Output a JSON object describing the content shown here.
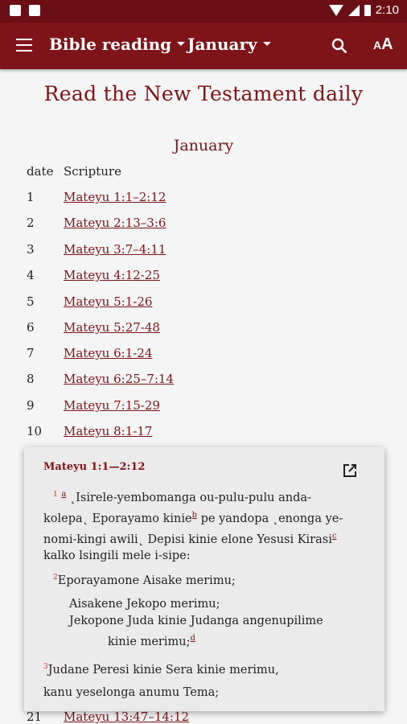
{
  "status": {
    "time": "2:10"
  },
  "appbar": {
    "dropdown_book": "Bible reading",
    "dropdown_month": "January",
    "icons": [
      "menu-icon",
      "search-icon",
      "text-size-icon"
    ],
    "text_size_label": "AA"
  },
  "page": {
    "title": "Read the New Testament daily",
    "month": "January",
    "col_date": "date",
    "col_scripture": "Scripture",
    "rows": [
      {
        "date": "1",
        "ref": "Mateyu 1:1–2:12"
      },
      {
        "date": "2",
        "ref": "Mateyu 2:13–3:6"
      },
      {
        "date": "3",
        "ref": "Mateyu 3:7–4:11"
      },
      {
        "date": "4",
        "ref": "Mateyu 4:12-25"
      },
      {
        "date": "5",
        "ref": "Mateyu 5:1-26"
      },
      {
        "date": "6",
        "ref": "Mateyu 5:27-48"
      },
      {
        "date": "7",
        "ref": "Mateyu 6:1-24"
      },
      {
        "date": "8",
        "ref": "Mateyu 6:25–7:14"
      },
      {
        "date": "9",
        "ref": "Mateyu 7:15-29"
      },
      {
        "date": "10",
        "ref": "Mateyu 8:1-17"
      },
      {
        "date": "21",
        "ref": "Mateyu 13:47–14:12"
      }
    ]
  },
  "popup": {
    "title": "Mateyu 1:1—2:12",
    "v1_num": "1",
    "v1_fn_a": "a",
    "v1_line1": "˛Isirele-yembomanga ou-pulu-pulu anda-",
    "v1_line2": "kolepa˛ Eporayamo kinie",
    "v1_fn_b": "b",
    "v1_line2b": " pe yandopa ˛enonga ye-",
    "v1_line3": "nomi-kingi awili˛ Depisi kinie elone Yesusi Kirasi",
    "v1_fn_c": "c",
    "v1_line4": "kalko lsingili mele i-sipe:",
    "v2_num": "2",
    "v2_text": "Eporayamone Aisake merimu;",
    "poem1": "Aisakene Jekopo merimu;",
    "poem2": "Jekopone Juda kinie Judanga angenupilime",
    "poem3": "kinie merimu;",
    "v2_fn_d": "d",
    "v3_num": "3",
    "v3_text": "Judane Peresi kinie Sera kinie merimu,",
    "v3_cont": "kanu yeselonga anumu Tema;"
  }
}
